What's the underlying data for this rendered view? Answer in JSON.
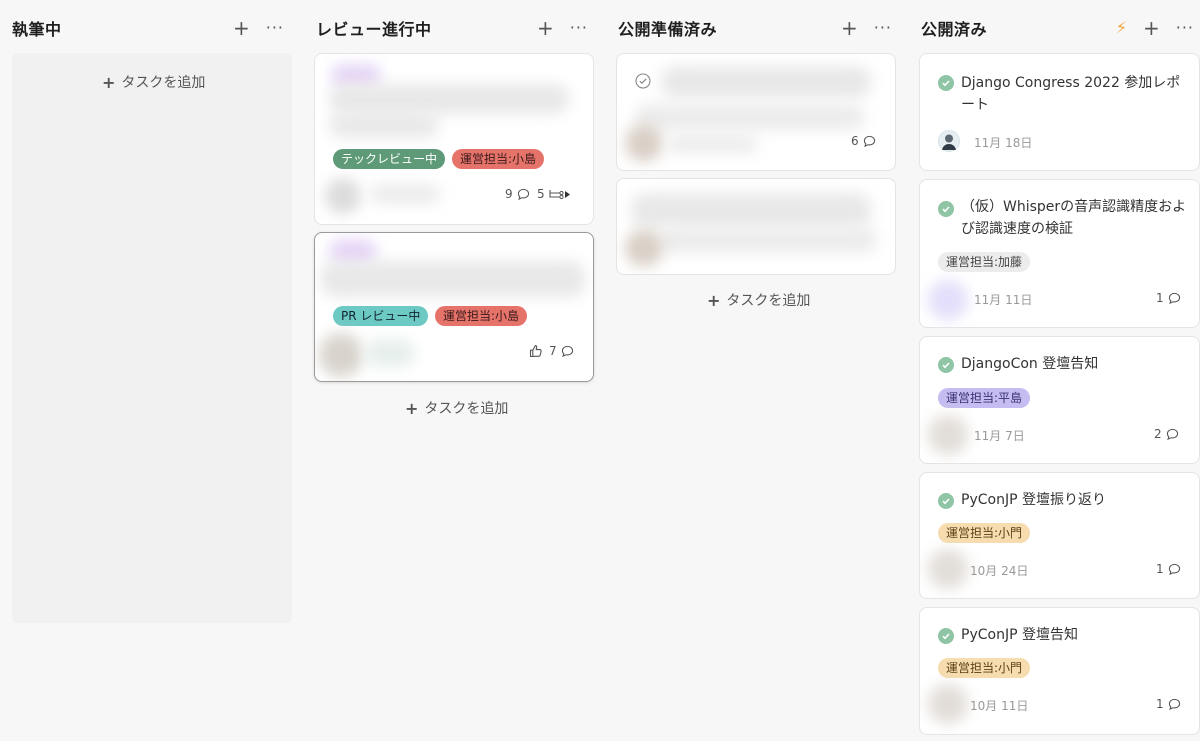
{
  "columns": [
    {
      "title": "執筆中",
      "add_task": "タスクを追加"
    },
    {
      "title": "レビュー進行中",
      "add_task": "タスクを追加"
    },
    {
      "title": "公開準備済み",
      "add_task": "タスクを追加"
    },
    {
      "title": "公開済み"
    }
  ],
  "review_cards": [
    {
      "tags": [
        "テックレビュー中",
        "運営担当:小島"
      ],
      "comments": "9",
      "subtasks": "5"
    },
    {
      "tags": [
        "PR レビュー中",
        "運営担当:小島"
      ],
      "likes": "",
      "comments": "7"
    }
  ],
  "ready_cards": [
    {
      "comments": "6"
    }
  ],
  "published_cards": [
    {
      "title": "Django Congress 2022 参加レポート",
      "date": "11月 18日",
      "tag": ""
    },
    {
      "title": "（仮）Whisperの音声認識精度および認識速度の検証",
      "tag": "運営担当:加藤",
      "date": "11月 11日",
      "comments": "1"
    },
    {
      "title": "DjangoCon 登壇告知",
      "tag": "運営担当:平島",
      "date": "11月 7日",
      "comments": "2"
    },
    {
      "title": "PyConJP 登壇振り返り",
      "tag": "運営担当:小門",
      "date": "10月 24日",
      "comments": "1"
    },
    {
      "title": "PyConJP 登壇告知",
      "tag": "運営担当:小門",
      "date": "10月 11日",
      "comments": "1"
    }
  ],
  "colors": {
    "tech_review": "#5e9a78",
    "pr_review": "#6cc9c3",
    "owner_red": "#e5736a",
    "owner_gray": "#ececec",
    "owner_purple": "#c5bdf2",
    "owner_yellow": "#f6dcae",
    "done_check": "#8fc5a4"
  }
}
